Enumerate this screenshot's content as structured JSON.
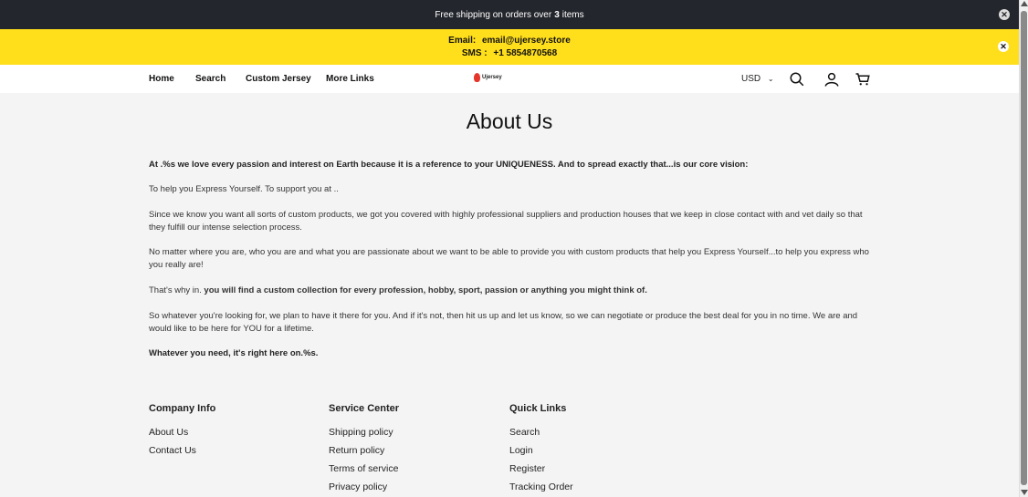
{
  "topbar": {
    "text_before": "Free shipping on orders over",
    "count": "3",
    "text_after": "items",
    "close_icon": "close-icon"
  },
  "promo": {
    "email_label": "Email:",
    "email_value": "email@ujersey.store",
    "sms_label": "SMS :",
    "sms_value": "+1 5854870568",
    "close_icon": "close-icon"
  },
  "nav": {
    "links": [
      "Home",
      "Search",
      "Custom Jersey",
      "More Links"
    ],
    "logo_text": "Ujersey",
    "currency": "USD",
    "icons": [
      "search-icon",
      "user-icon",
      "cart-icon"
    ]
  },
  "about": {
    "title": "About Us",
    "p1": "At .%s we love every passion and interest on Earth because it is a reference to your UNIQUENESS. And to spread exactly that...is our core vision:",
    "p2": "To help you Express Yourself. To support you at ..",
    "p3": "Since we know you want all sorts of custom products, we got you covered with highly professional suppliers and production houses that we keep in close contact with and vet daily so that they fulfill our intense selection process.",
    "p4": "No matter where you are, who you are and what you are passionate about we want to be able to provide you with custom products that help you Express Yourself...to help you express who you really are!",
    "p5_plain": "That's why in.",
    "p5_bold": "you will find a custom collection for every profession, hobby, sport, passion or anything you might think of.",
    "p6": "So whatever you're looking for, we plan to have it there for you. And if it's not, then hit us up and let us know, so we can negotiate or produce the best deal for you in no time. We are and would like to be here for YOU for a lifetime.",
    "p7": "Whatever you need, it's right here on.%s."
  },
  "footer": {
    "company": {
      "title": "Company Info",
      "items": [
        "About Us",
        "Contact Us"
      ]
    },
    "service": {
      "title": "Service Center",
      "items": [
        "Shipping policy",
        "Return policy",
        "Terms of service",
        "Privacy policy"
      ]
    },
    "quick": {
      "title": "Quick Links",
      "items": [
        "Search",
        "Login",
        "Register",
        "Tracking Order"
      ]
    }
  }
}
